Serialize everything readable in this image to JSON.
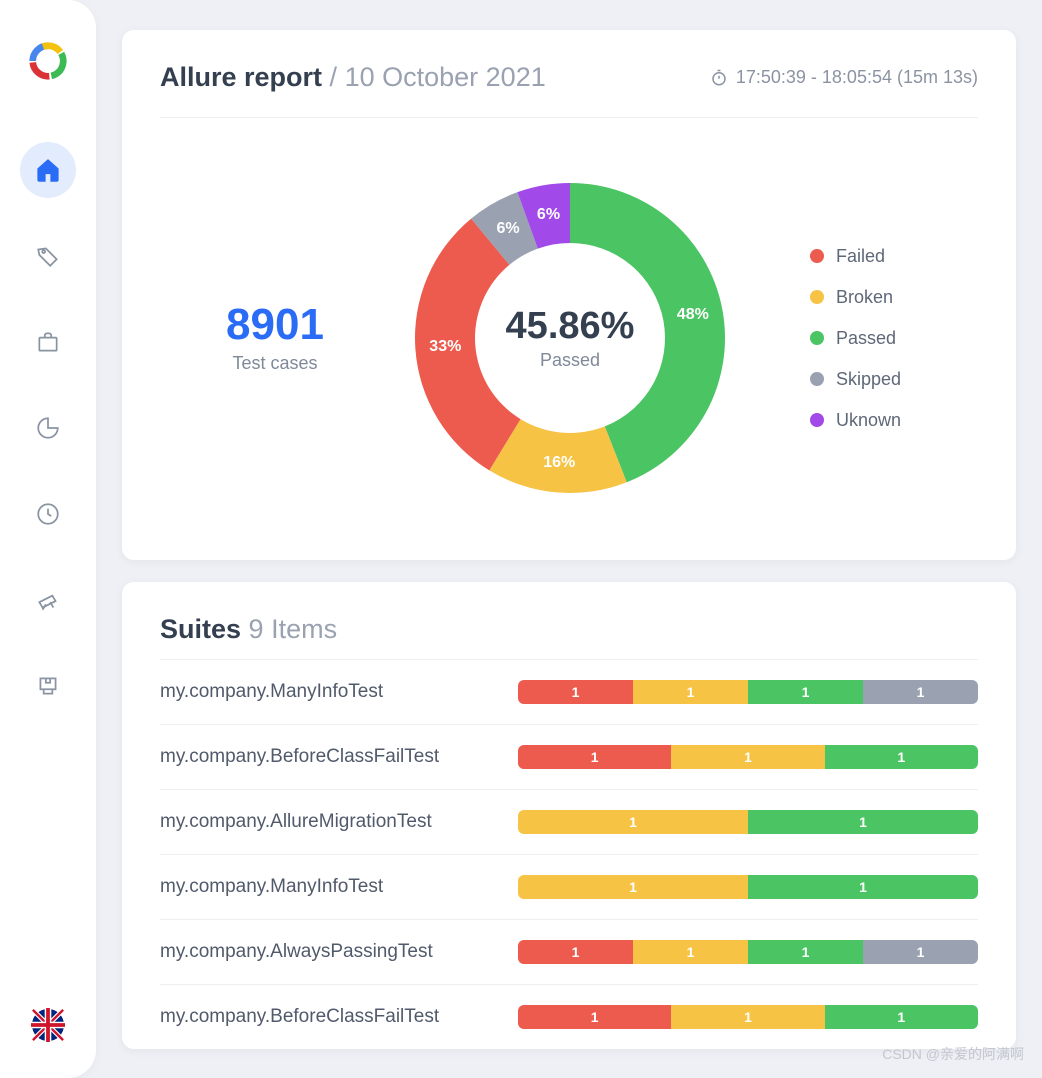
{
  "header": {
    "title": "Allure report",
    "separator": "/",
    "date": "10 October 2021",
    "time_range": "17:50:39 - 18:05:54 (15m 13s)"
  },
  "summary": {
    "count": "8901",
    "count_label": "Test cases",
    "center_percent": "45.86%",
    "center_label": "Passed"
  },
  "colors": {
    "failed": "#ec5b4d",
    "broken": "#f6c344",
    "passed": "#4bc464",
    "skipped": "#9aa2b1",
    "unknown": "#a24ae9"
  },
  "legend": [
    {
      "key": "failed",
      "label": "Failed"
    },
    {
      "key": "broken",
      "label": "Broken"
    },
    {
      "key": "passed",
      "label": "Passed"
    },
    {
      "key": "skipped",
      "label": "Skipped"
    },
    {
      "key": "unknown",
      "label": "Uknown"
    }
  ],
  "chart_data": {
    "type": "pie",
    "title": "",
    "series": [
      {
        "name": "Passed",
        "value": 48,
        "label": "48%",
        "color_key": "passed"
      },
      {
        "name": "Broken",
        "value": 16,
        "label": "16%",
        "color_key": "broken"
      },
      {
        "name": "Failed",
        "value": 33,
        "label": "33%",
        "color_key": "failed"
      },
      {
        "name": "Skipped",
        "value": 6,
        "label": "6%",
        "color_key": "skipped"
      },
      {
        "name": "Uknown",
        "value": 6,
        "label": "6%",
        "color_key": "unknown"
      }
    ]
  },
  "suites": {
    "title": "Suites",
    "subtitle": "9 Items",
    "items": [
      {
        "name": "my.company.ManyInfoTest",
        "segments": [
          {
            "k": "failed",
            "v": "1"
          },
          {
            "k": "broken",
            "v": "1"
          },
          {
            "k": "passed",
            "v": "1"
          },
          {
            "k": "skipped",
            "v": "1"
          }
        ]
      },
      {
        "name": "my.company.BeforeClassFailTest",
        "segments": [
          {
            "k": "failed",
            "v": "1"
          },
          {
            "k": "broken",
            "v": "1"
          },
          {
            "k": "passed",
            "v": "1"
          }
        ]
      },
      {
        "name": "my.company.AllureMigrationTest",
        "segments": [
          {
            "k": "broken",
            "v": "1"
          },
          {
            "k": "passed",
            "v": "1"
          }
        ]
      },
      {
        "name": "my.company.ManyInfoTest",
        "segments": [
          {
            "k": "broken",
            "v": "1"
          },
          {
            "k": "passed",
            "v": "1"
          }
        ]
      },
      {
        "name": "my.company.AlwaysPassingTest",
        "segments": [
          {
            "k": "failed",
            "v": "1"
          },
          {
            "k": "broken",
            "v": "1"
          },
          {
            "k": "passed",
            "v": "1"
          },
          {
            "k": "skipped",
            "v": "1"
          }
        ]
      },
      {
        "name": "my.company.BeforeClassFailTest",
        "segments": [
          {
            "k": "failed",
            "v": "1"
          },
          {
            "k": "broken",
            "v": "1"
          },
          {
            "k": "passed",
            "v": "1"
          }
        ]
      }
    ]
  },
  "sidebar": {
    "icons": [
      "home",
      "tags",
      "suitcase",
      "graphs",
      "timeline",
      "behaviors",
      "packages"
    ]
  },
  "watermark": "CSDN @亲爱的阿满啊"
}
